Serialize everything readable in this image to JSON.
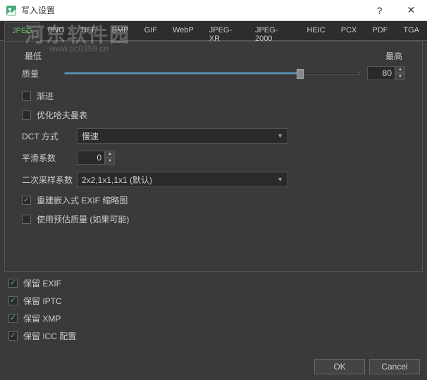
{
  "window": {
    "title": "写入设置",
    "help": "?",
    "close": "✕"
  },
  "watermark": {
    "text": "河东软件园",
    "url": "www.pc0359.cn"
  },
  "tabs": [
    "JPEG",
    "PNG",
    "TIFF",
    "BMP",
    "GIF",
    "WebP",
    "JPEG-XR",
    "JPEG-2000",
    "HEIC",
    "PCX",
    "PDF",
    "TGA"
  ],
  "activeTab": 0,
  "quality": {
    "minLabel": "最低",
    "maxLabel": "最高",
    "label": "质量",
    "value": "80"
  },
  "progressive": {
    "label": "渐进",
    "checked": false
  },
  "optimizeHuffman": {
    "label": "优化哈夫曼表",
    "checked": false
  },
  "dct": {
    "label": "DCT 方式",
    "value": "慢速"
  },
  "smoothing": {
    "label": "平滑系数",
    "value": "0"
  },
  "subsampling": {
    "label": "二次采样系数",
    "value": "2x2,1x1,1x1 (默认)"
  },
  "rebuildExif": {
    "label": "重建嵌入式 EXIF 缩略图",
    "checked": true
  },
  "useEstimated": {
    "label": "使用预估质量 (如果可能)",
    "checked": false
  },
  "keepExif": {
    "label": "保留 EXIF",
    "checked": true
  },
  "keepIptc": {
    "label": "保留 IPTC",
    "checked": true
  },
  "keepXmp": {
    "label": "保留 XMP",
    "checked": true
  },
  "keepIcc": {
    "label": "保留 ICC 配置",
    "checked": true
  },
  "buttons": {
    "ok": "OK",
    "cancel": "Cancel"
  }
}
